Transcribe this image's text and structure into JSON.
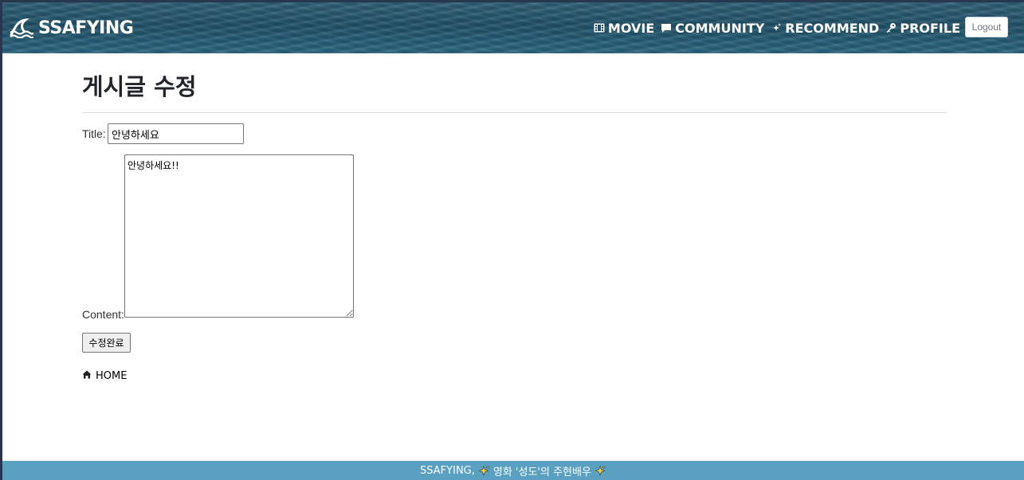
{
  "brand": {
    "name": "SSAFYING",
    "icon": "wave-icon"
  },
  "nav": {
    "items": [
      {
        "label": "MOVIE",
        "icon": "film-icon"
      },
      {
        "label": "COMMUNITY",
        "icon": "chat-bubble-icon"
      },
      {
        "label": "RECOMMEND",
        "icon": "sparkle-icon"
      },
      {
        "label": "PROFILE",
        "icon": "key-icon"
      }
    ],
    "logout_label": "Logout"
  },
  "page": {
    "title": "게시글 수정"
  },
  "form": {
    "title_label": "Title:",
    "title_value": "안녕하세요",
    "content_label": "Content:",
    "content_value": "안녕하세요!!",
    "submit_label": "수정완료"
  },
  "home_link": {
    "label": "HOME",
    "icon": "home-icon"
  },
  "footer": {
    "prefix": "SSAFYING,",
    "text": "영화 '성도'의 주현배우",
    "icon": "sparkles-icon"
  },
  "colors": {
    "footer_bg": "#5aa0c0",
    "navbar_bg": "#1f4f66",
    "text_dark": "#212529"
  }
}
